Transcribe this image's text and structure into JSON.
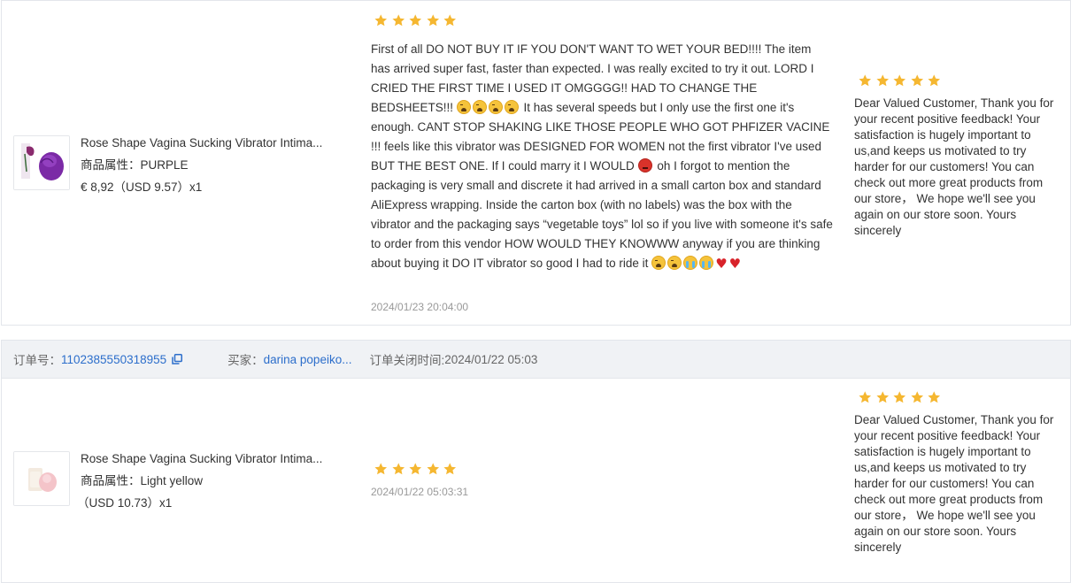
{
  "review1": {
    "product": {
      "title": "Rose Shape Vagina Sucking Vibrator Intima...",
      "attr": "商品属性：PURPLE",
      "price": "€ 8,92（USD  9.57）x1"
    },
    "rating": 5,
    "text_parts": [
      "First of all DO NOT BUY IT IF YOU DON'T WANT TO WET YOUR BED!!!! The item has arrived super fast, faster than expected. I was really excited to try it out. LORD I CRIED THE FIRST TIME I USED IT OMGGGG!! HAD TO CHANGE THE BEDSHEETS!!! ",
      " It has several speeds but I only use the first one it's enough. CANT STOP SHAKING LIKE THOSE PEOPLE WHO GOT PHFIZER VACINE !!! feels like this vibrator was DESIGNED FOR WOMEN not the first vibrator I've used BUT THE BEST ONE. If I could marry it I WOULD ",
      " oh I forgot to mention the packaging is very small and discrete it had arrived in a small carton box and standard AliExpress wrapping. Inside the carton box (with no labels) was the box with the vibrator and the packaging says “vegetable toys” lol so if you live with someone it's safe to order from this vendor HOW WOULD THEY KNOWWW anyway if you are thinking about buying it DO IT vibrator so good I had to ride it "
    ],
    "heart_glyph": "♥",
    "date": "2024/01/23 20:04:00",
    "reply_rating": 5,
    "reply": "Dear Valued Customer, Thank you for your recent positive feedback! Your satisfaction is hugely important to us,and keeps us motivated to try harder for our customers! You can check out more great products from our store， We hope we'll see you again on our store soon. Yours sincerely"
  },
  "order_bar": {
    "order_label": "订单号：",
    "order_no": "1102385550318955",
    "buyer_label": "买家：",
    "buyer": "darina popeiko...",
    "closed_label": "订单关闭时间:",
    "closed_time": "2024/01/22 05:03"
  },
  "review2": {
    "product": {
      "title": "Rose Shape Vagina Sucking Vibrator Intima...",
      "attr": "商品属性：Light yellow",
      "price": "（USD  10.73）x1"
    },
    "rating": 5,
    "date": "2024/01/22 05:03:31",
    "reply_rating": 5,
    "reply": "Dear Valued Customer, Thank you for your recent positive feedback! Your satisfaction is hugely important to us,and keeps us motivated to try harder for our customers! You can check out more great products from our store， We hope we'll see you again on our store soon. Yours sincerely"
  },
  "colors": {
    "star": "#f5b731",
    "link": "#2c6ecb",
    "heart": "#d8232a"
  }
}
